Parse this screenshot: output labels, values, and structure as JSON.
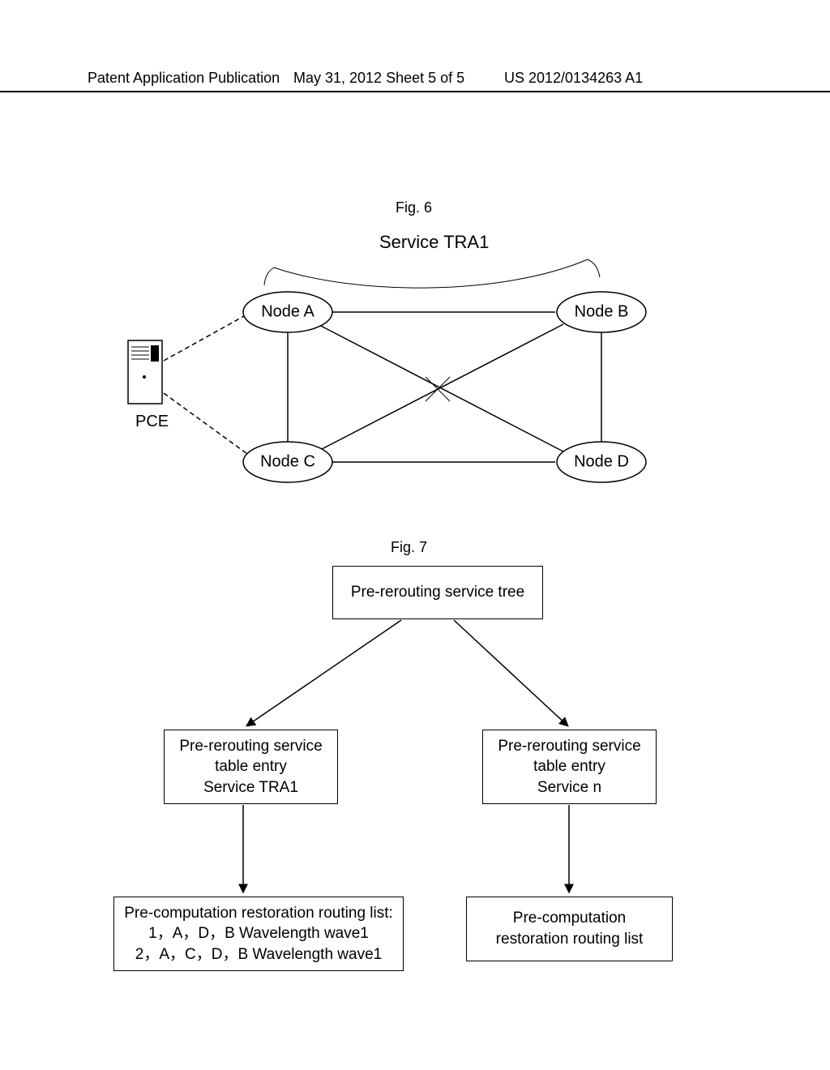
{
  "header": {
    "left": "Patent Application Publication",
    "center": "May 31, 2012  Sheet 5 of 5",
    "right": "US 2012/0134263 A1"
  },
  "fig6": {
    "label": "Fig. 6",
    "service": "Service TRA1",
    "nodes": {
      "A": "Node A",
      "B": "Node B",
      "C": "Node C",
      "D": "Node D"
    },
    "pce": "PCE"
  },
  "fig7": {
    "label": "Fig. 7",
    "root": "Pre-rerouting service tree",
    "left_entry_l1": "Pre-rerouting service",
    "left_entry_l2": "table entry",
    "left_entry_l3": "Service TRA1",
    "right_entry_l1": "Pre-rerouting service",
    "right_entry_l2": "table entry",
    "right_entry_l3": "Service n",
    "left_list_l1": "Pre-computation restoration routing list:",
    "left_list_l2": "1，A，D，B Wavelength wave1",
    "left_list_l3": "2，A，C，D，B Wavelength wave1",
    "right_list_l1": "Pre-computation",
    "right_list_l2": "restoration routing list"
  }
}
